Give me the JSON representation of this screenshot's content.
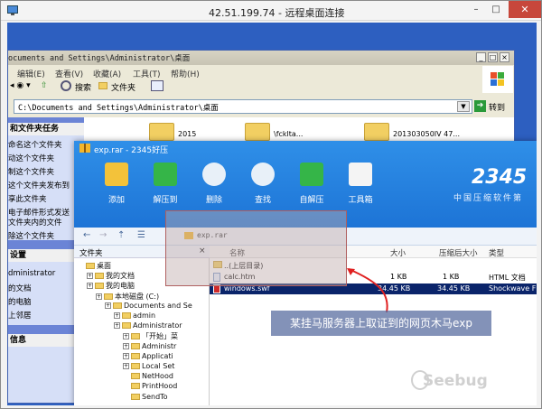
{
  "rdp": {
    "title": "42.51.199.74 - 远程桌面连接",
    "btn_min": "–",
    "btn_max": "□",
    "btn_close": "✕"
  },
  "explorer": {
    "title": "ocuments and Settings\\Administrator\\桌面",
    "menu": [
      "编辑(E)",
      "查看(V)",
      "收藏(A)",
      "工具(T)",
      "帮助(H)"
    ],
    "toolbar": {
      "search": "搜索",
      "folders": "文件夹"
    },
    "address": "C:\\Documents and Settings\\Administrator\\桌面",
    "go_label": "转到",
    "task_head": "和文件夹任务",
    "tasks": [
      "命名这个文件夹",
      "动这个文件夹",
      "制这个文件夹",
      "这个文件夹发布到",
      "享此文件夹",
      "电子邮件形式发送",
      "文件夹内的文件",
      "除这个文件夹"
    ],
    "places_head": "设置",
    "places": [
      "dministrator",
      "的文档",
      "的电脑",
      "上邻居"
    ],
    "details_head": "信息",
    "desktop_items": [
      "2015",
      "\\fcklta...",
      "201303050IV 47..."
    ]
  },
  "zip": {
    "title": "exp.rar - 2345好压",
    "tools": [
      {
        "label": "添加",
        "icon": "add-icon"
      },
      {
        "label": "解压到",
        "icon": "extract-to-icon"
      },
      {
        "label": "删除",
        "icon": "delete-icon"
      },
      {
        "label": "查找",
        "icon": "search-icon"
      },
      {
        "label": "自解压",
        "icon": "self-extract-icon"
      },
      {
        "label": "工具箱",
        "icon": "toolbox-icon"
      }
    ],
    "brand": "2345",
    "brand_sub": "中国压缩软件第",
    "path": "exp.rar",
    "tree_head": "文件夹",
    "tree_close": "×",
    "tree": [
      {
        "label": "桌面",
        "indent": 0
      },
      {
        "label": "我的文档",
        "indent": 1
      },
      {
        "label": "我的电脑",
        "indent": 1
      },
      {
        "label": "本地磁盘 (C:)",
        "indent": 2
      },
      {
        "label": "Documents and Se",
        "indent": 3
      },
      {
        "label": "admin",
        "indent": 4
      },
      {
        "label": "Administrator",
        "indent": 4
      },
      {
        "label": "「开始」菜",
        "indent": 5
      },
      {
        "label": "Administr",
        "indent": 5
      },
      {
        "label": "Applicati",
        "indent": 5
      },
      {
        "label": "Local Set",
        "indent": 5
      },
      {
        "label": "NetHood",
        "indent": 5
      },
      {
        "label": "PrintHood",
        "indent": 5
      },
      {
        "label": "SendTo",
        "indent": 5
      }
    ],
    "columns": {
      "name": "名称",
      "size": "大小",
      "packed": "压缩后大小",
      "type": "类型"
    },
    "rows": [
      {
        "name": "..(上层目录)",
        "size": "",
        "packed": "",
        "type": ""
      },
      {
        "name": "calc.htm",
        "size": "1 KB",
        "packed": "1 KB",
        "type": "HTML 文档"
      },
      {
        "name": "windows.swf",
        "size": "34.45 KB",
        "packed": "34.45 KB",
        "type": "Shockwave F"
      }
    ]
  },
  "annotation": "某挂马服务器上取证到的网页木马exp",
  "watermark": "Seebug",
  "colors": {
    "accent": "#1d74d6",
    "callout": "#5a6ea0",
    "arrow": "#e02020"
  }
}
